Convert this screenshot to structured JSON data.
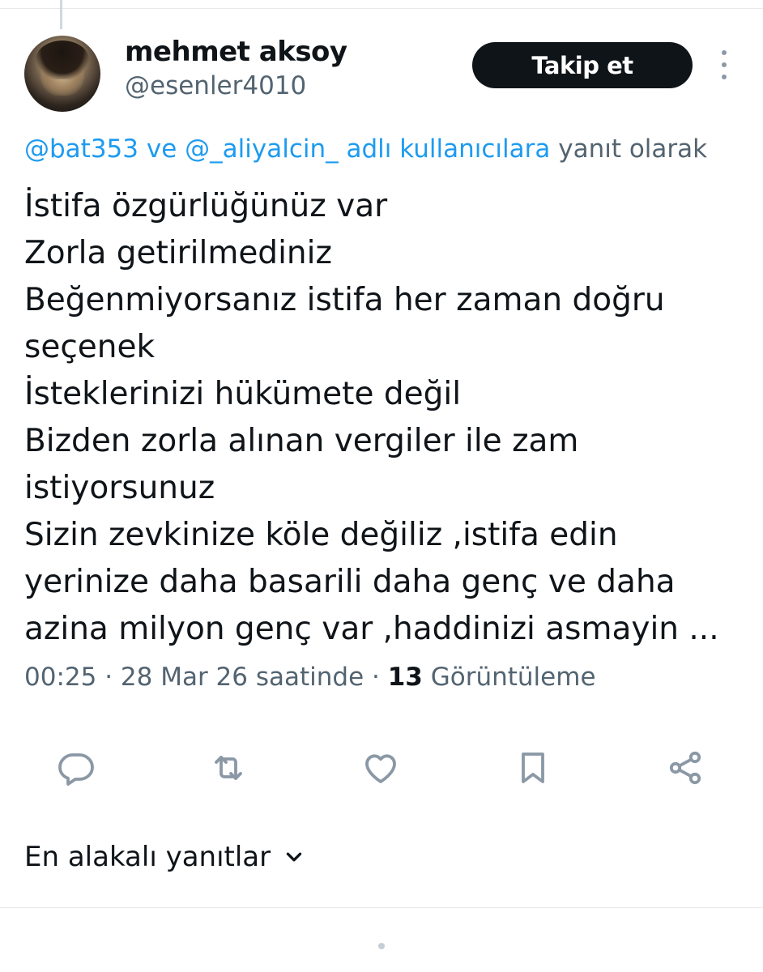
{
  "user": {
    "display_name": "mehmet aksoy",
    "handle": "@esenler4010",
    "follow_label": "Takip et"
  },
  "reply_context": {
    "mention_1": "@bat353",
    "joiner": " ve ",
    "mention_2": "@_aliyalcin_",
    "mid": " adlı kullanıcılara",
    "suffix": " yanıt olarak"
  },
  "tweet": {
    "lines": [
      "İstifa özgürlüğünüz var",
      "Zorla getirilmediniz",
      "Beğenmiyorsanız istifa her zaman doğru",
      "seçenek",
      "İsteklerinizi hükümete değil",
      "Bizden zorla alınan vergiler ile zam",
      "istiyorsunuz",
      "Sizin zevkinize köle değiliz ,istifa edin",
      "yerinize daha basarili daha genç ve daha",
      "azina milyon genç var ,haddinizi asmayin ..."
    ]
  },
  "meta": {
    "time": "00:25",
    "sep1": " · ",
    "date": "28 Mar 26 saatinde",
    "sep2": " · ",
    "views_count": "13",
    "views_label": " Görüntüleme"
  },
  "actions": {
    "icons": [
      "reply-icon",
      "retweet-icon",
      "like-icon",
      "bookmark-icon",
      "share-icon"
    ],
    "icon_color": "#8b98a5"
  },
  "replies_sort": {
    "label": "En alakalı yanıtlar"
  },
  "colors": {
    "link": "#1d9bf0",
    "secondary_text": "#536471",
    "primary_text": "#0f1419",
    "button_bg": "#0f1419"
  }
}
